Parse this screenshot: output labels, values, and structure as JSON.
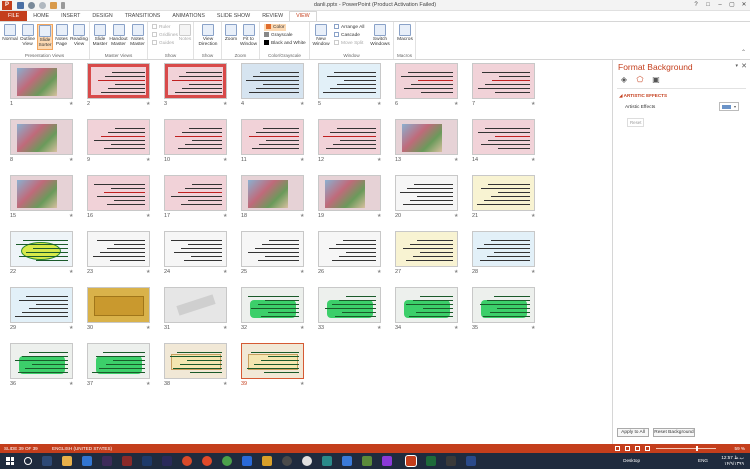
{
  "titlebar": {
    "doc_title": "danli.pptx - PowerPoint (Product Activation Failed)",
    "app_letter": "P",
    "qat": [
      "save-icon",
      "undo-icon",
      "redo-icon",
      "present-icon",
      "customize-icon"
    ],
    "controls": [
      "?",
      "□",
      "–",
      "▢",
      "✕"
    ]
  },
  "tabs": [
    "FILE",
    "HOME",
    "INSERT",
    "DESIGN",
    "TRANSITIONS",
    "ANIMATIONS",
    "SLIDE SHOW",
    "REVIEW",
    "VIEW"
  ],
  "active_tab": "VIEW",
  "ribbon": {
    "groups": [
      {
        "name": "Presentation Views",
        "buttons": [
          "Normal",
          "Outline View",
          "Slide Sorter",
          "Notes Page",
          "Reading View"
        ]
      },
      {
        "name": "Master Views",
        "buttons": [
          "Slide Master",
          "Handout Master",
          "Notes Master"
        ]
      },
      {
        "name": "Show",
        "items": [
          "Ruler",
          "Gridlines",
          "Guides"
        ],
        "buttons": [
          "Notes"
        ]
      },
      {
        "name": "Show",
        "buttons": [
          "View Direction"
        ]
      },
      {
        "name": "Zoom",
        "buttons": [
          "Zoom",
          "Fit to Window"
        ]
      },
      {
        "name": "Color/Grayscale",
        "items": [
          "Color",
          "Grayscale",
          "Black and White"
        ]
      },
      {
        "name": "Window",
        "buttons": [
          "New Window"
        ],
        "items": [
          "Arrange All",
          "Cascade",
          "Move Split"
        ],
        "extra": [
          "Switch Windows"
        ]
      },
      {
        "name": "Macros",
        "buttons": [
          "Macros"
        ]
      }
    ]
  },
  "slides": [
    {
      "n": "1"
    },
    {
      "n": "2"
    },
    {
      "n": "3"
    },
    {
      "n": "4"
    },
    {
      "n": "5"
    },
    {
      "n": "6"
    },
    {
      "n": "7"
    },
    {
      "n": "8"
    },
    {
      "n": "9"
    },
    {
      "n": "10"
    },
    {
      "n": "11"
    },
    {
      "n": "12"
    },
    {
      "n": "13"
    },
    {
      "n": "14"
    },
    {
      "n": "15"
    },
    {
      "n": "16"
    },
    {
      "n": "17"
    },
    {
      "n": "18"
    },
    {
      "n": "19"
    },
    {
      "n": "20"
    },
    {
      "n": "21"
    },
    {
      "n": "22"
    },
    {
      "n": "23"
    },
    {
      "n": "24"
    },
    {
      "n": "25"
    },
    {
      "n": "26"
    },
    {
      "n": "27"
    },
    {
      "n": "28"
    },
    {
      "n": "29"
    },
    {
      "n": "30"
    },
    {
      "n": "31"
    },
    {
      "n": "32"
    },
    {
      "n": "33"
    },
    {
      "n": "34"
    },
    {
      "n": "35"
    },
    {
      "n": "36"
    },
    {
      "n": "37"
    },
    {
      "n": "38"
    },
    {
      "n": "39"
    }
  ],
  "selected_slide": "39",
  "pane": {
    "title": "Format Background",
    "section": "ARTISTIC EFFECTS",
    "label": "Artistic Effects",
    "reset_link": "Reset",
    "apply_all": "Apply to All",
    "reset_bg": "Reset Background"
  },
  "status": {
    "slide": "SLIDE 39 OF 39",
    "lang": "ENGLISH (UNITED STATES)",
    "zoom": "59 %"
  },
  "taskbar": {
    "desktop": "Desktop",
    "lang": "ENG",
    "time": "12:57 ب.ظ",
    "date": "۱۴/۹/۱۳۹۹"
  },
  "colors": {
    "accent": "#c43e1c",
    "selected_border": "#d55a34",
    "taskbar": "#1f2b3e"
  }
}
